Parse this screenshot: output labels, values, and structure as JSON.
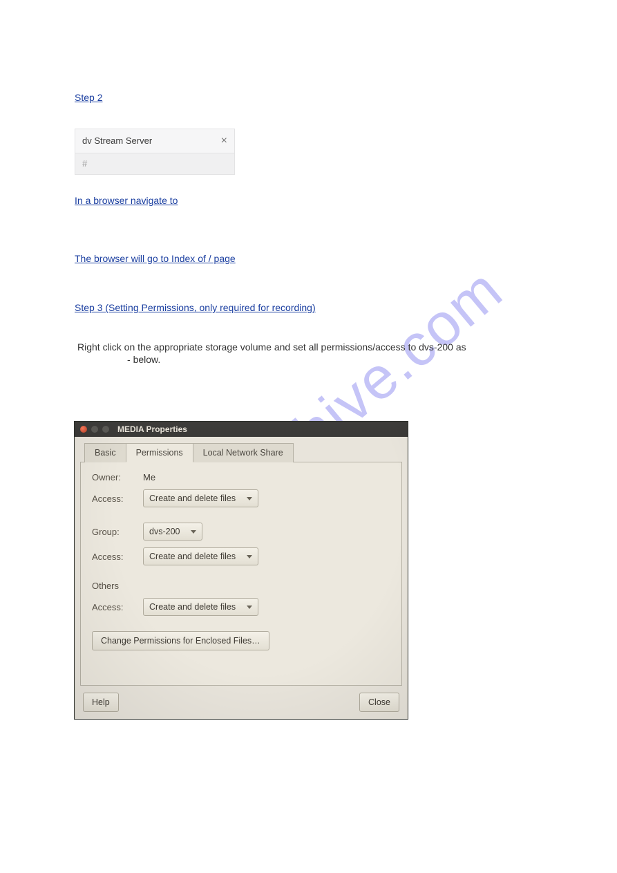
{
  "watermark": "manualshive.com",
  "links": {
    "step2": "Step 2",
    "step2b": "In a browser navigate to",
    "step2c": "The browser will go to Index of / page",
    "step3": "Step 3 (Setting Permissions, only required for recording)"
  },
  "text": {
    "indent_line": "Right click on the appropriate storage volume and set all permissions/access to dvs-200 as",
    "below": "below.",
    "dash": "-"
  },
  "tab": {
    "title": "dv Stream Server",
    "url_placeholder": "#"
  },
  "dialog": {
    "title": "MEDIA Properties",
    "tabs": [
      "Basic",
      "Permissions",
      "Local Network Share"
    ],
    "owner_label": "Owner:",
    "owner_value": "Me",
    "access_label": "Access:",
    "access_value": "Create and delete files",
    "group_label": "Group:",
    "group_value": "dvs-200",
    "others_label": "Others",
    "change_perms": "Change Permissions for Enclosed Files…",
    "help": "Help",
    "close": "Close"
  }
}
